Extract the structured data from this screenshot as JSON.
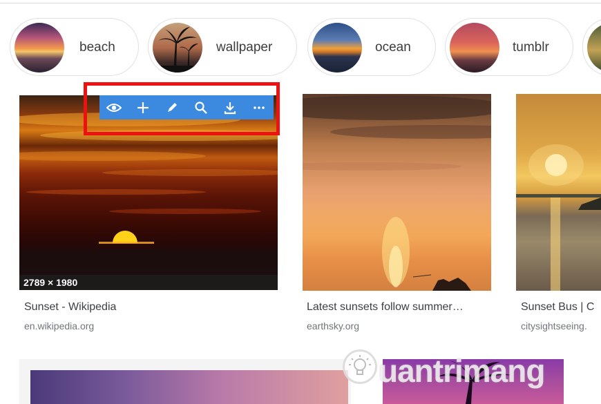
{
  "chips": [
    {
      "label": "beach"
    },
    {
      "label": "wallpaper"
    },
    {
      "label": "ocean"
    },
    {
      "label": "tumblr"
    }
  ],
  "cards": [
    {
      "title": "Sunset - Wikipedia",
      "source": "en.wikipedia.org",
      "dimensions": "2789 × 1980"
    },
    {
      "title": "Latest sunsets follow summer…",
      "source": "earthsky.org"
    },
    {
      "title": "Sunset Bus | C",
      "source": "citysightseeing."
    }
  ],
  "toolbar": {
    "icons": [
      "eye-icon",
      "plus-icon",
      "pencil-icon",
      "search-icon",
      "download-icon",
      "more-icon"
    ],
    "color": "#3c8ae0"
  },
  "highlight_color": "#ee1111",
  "watermark": {
    "text": "uantrimang"
  }
}
